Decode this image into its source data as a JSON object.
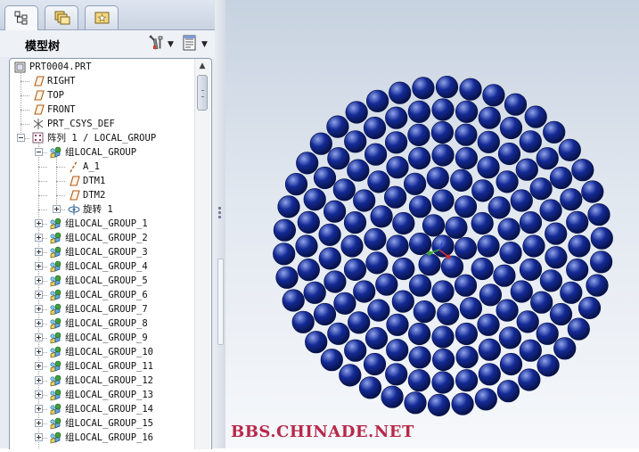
{
  "model_tree": {
    "title": "模型树",
    "tabs": [
      {
        "icon": "model-tree-tab-icon",
        "active": true
      },
      {
        "icon": "layers-tab-icon",
        "active": false
      },
      {
        "icon": "favorites-tab-icon",
        "active": false
      }
    ],
    "toolbar": {
      "settings_icon": "tools-icon",
      "show_icon": "show-icon",
      "dropdown_glyph": "▼"
    },
    "items": [
      {
        "label": "PRT0004.PRT",
        "icon": "part-icon"
      },
      {
        "label": "RIGHT",
        "icon": "datum-plane-icon"
      },
      {
        "label": "TOP",
        "icon": "datum-plane-icon"
      },
      {
        "label": "FRONT",
        "icon": "datum-plane-icon"
      },
      {
        "label": "PRT_CSYS_DEF",
        "icon": "coordinate-system-icon"
      },
      {
        "label": "阵列 1 / LOCAL_GROUP",
        "icon": "pattern-icon"
      },
      {
        "label": "组LOCAL_GROUP",
        "icon": "group-icon"
      },
      {
        "label": "A_1",
        "icon": "datum-axis-icon"
      },
      {
        "label": "DTM1",
        "icon": "datum-plane-icon"
      },
      {
        "label": "DTM2",
        "icon": "datum-plane-icon"
      },
      {
        "label": "旋转 1",
        "icon": "revolve-icon"
      },
      {
        "label": "组LOCAL_GROUP_1",
        "icon": "group-icon"
      },
      {
        "label": "组LOCAL_GROUP_2",
        "icon": "group-icon"
      },
      {
        "label": "组LOCAL_GROUP_3",
        "icon": "group-icon"
      },
      {
        "label": "组LOCAL_GROUP_4",
        "icon": "group-icon"
      },
      {
        "label": "组LOCAL_GROUP_5",
        "icon": "group-icon"
      },
      {
        "label": "组LOCAL_GROUP_6",
        "icon": "group-icon"
      },
      {
        "label": "组LOCAL_GROUP_7",
        "icon": "group-icon"
      },
      {
        "label": "组LOCAL_GROUP_8",
        "icon": "group-icon"
      },
      {
        "label": "组LOCAL_GROUP_9",
        "icon": "group-icon"
      },
      {
        "label": "组LOCAL_GROUP_10",
        "icon": "group-icon"
      },
      {
        "label": "组LOCAL_GROUP_11",
        "icon": "group-icon"
      },
      {
        "label": "组LOCAL_GROUP_12",
        "icon": "group-icon"
      },
      {
        "label": "组LOCAL_GROUP_13",
        "icon": "group-icon"
      },
      {
        "label": "组LOCAL_GROUP_14",
        "icon": "group-icon"
      },
      {
        "label": "组LOCAL_GROUP_15",
        "icon": "group-icon"
      },
      {
        "label": "组LOCAL_GROUP_16",
        "icon": "group-icon"
      }
    ],
    "scroll_up_glyph": "▲"
  },
  "graphics": {
    "rings": [
      {
        "count": 1
      },
      {
        "count": 6
      },
      {
        "count": 12
      },
      {
        "count": 18
      },
      {
        "count": 24
      },
      {
        "count": 30
      },
      {
        "count": 36
      },
      {
        "count": 42
      }
    ],
    "sphere_color": "#142a96",
    "sphere_highlight": "#8fa3ea",
    "triad_colors": {
      "x": "#3aa63a",
      "y": "#d03030",
      "z": "#2a4fd0"
    }
  },
  "watermark": {
    "text": "BBS.CHINADE.NET",
    "color": "#b8284a"
  },
  "colors": {
    "panel_bg": "#e8ecf2",
    "viewport_top": "#c7d2e0",
    "viewport_bottom": "#f6f8fb"
  }
}
